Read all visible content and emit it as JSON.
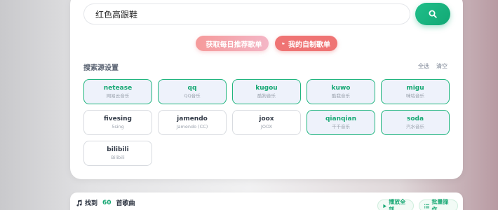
{
  "search": {
    "value": "红色高跟鞋"
  },
  "actions": {
    "daily_label": "获取每日推荐歌单",
    "mine_label": "我的自制歌单"
  },
  "sources_section": {
    "title": "搜索源设置",
    "select_all": "全选",
    "clear": "清空",
    "items": [
      {
        "name": "netease",
        "sub": "网易云音乐",
        "active": true
      },
      {
        "name": "qq",
        "sub": "QQ音乐",
        "active": true
      },
      {
        "name": "kugou",
        "sub": "酷狗音乐",
        "active": true
      },
      {
        "name": "kuwo",
        "sub": "酷我音乐",
        "active": true
      },
      {
        "name": "migu",
        "sub": "咪咕音乐",
        "active": true
      },
      {
        "name": "fivesing",
        "sub": "5sing",
        "active": false
      },
      {
        "name": "jamendo",
        "sub": "Jamendo (CC)",
        "active": false
      },
      {
        "name": "joox",
        "sub": "JOOX",
        "active": false
      },
      {
        "name": "qianqian",
        "sub": "千千音乐",
        "active": true
      },
      {
        "name": "soda",
        "sub": "汽水音乐",
        "active": true
      },
      {
        "name": "bilibili",
        "sub": "Bilibili",
        "active": false
      }
    ]
  },
  "results": {
    "prefix": "找到",
    "count": "60",
    "suffix": "首歌曲",
    "play_all": "播放全部",
    "batch": "批量操作"
  },
  "colors": {
    "accent": "#17a874",
    "active_bg": "#eef2fb",
    "daily_pill": "#f59a9a",
    "mine_pill": "#ef7474"
  }
}
